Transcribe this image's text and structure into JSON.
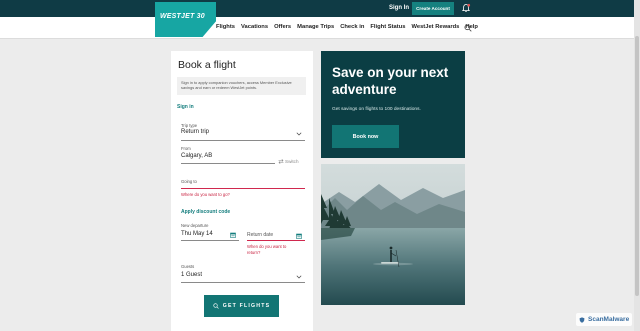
{
  "header": {
    "logo_text": "WESTJET 30",
    "sign_in": "Sign In",
    "create_account": "Create Account",
    "nav": [
      "Flights",
      "Vacations",
      "Offers",
      "Manage Trips",
      "Check in",
      "Flight Status",
      "WestJet Rewards",
      "Help"
    ]
  },
  "booking": {
    "title": "Book a flight",
    "info": "Sign in to apply companion vouchers, access Member Exclusive savings and earn or redeem WestJet points.",
    "sign_in_link": "Sign in",
    "trip_type": {
      "label": "Trip type",
      "value": "Return trip"
    },
    "from": {
      "label": "From",
      "value": "Calgary, AB"
    },
    "switch_label": "Switch",
    "going_to": {
      "label": "Going to",
      "error": "Where do you want to go?"
    },
    "discount_link": "Apply discount code",
    "departure": {
      "label": "New departure",
      "value": "Thu May 14"
    },
    "return": {
      "label": "Return date",
      "error": "When do you want to return?"
    },
    "guests": {
      "label": "Guests",
      "value": "1 Guest"
    },
    "get_flights": "GET FLIGHTS"
  },
  "promo": {
    "title": "Save on your next adventure",
    "subtitle": "Get savings on flights to 100 destinations.",
    "cta": "Book now"
  },
  "watermark": "ScanMalware",
  "colors": {
    "header": "#0f3b45",
    "teal": "#17a6a3",
    "button": "#127574",
    "error": "#d0284e"
  }
}
